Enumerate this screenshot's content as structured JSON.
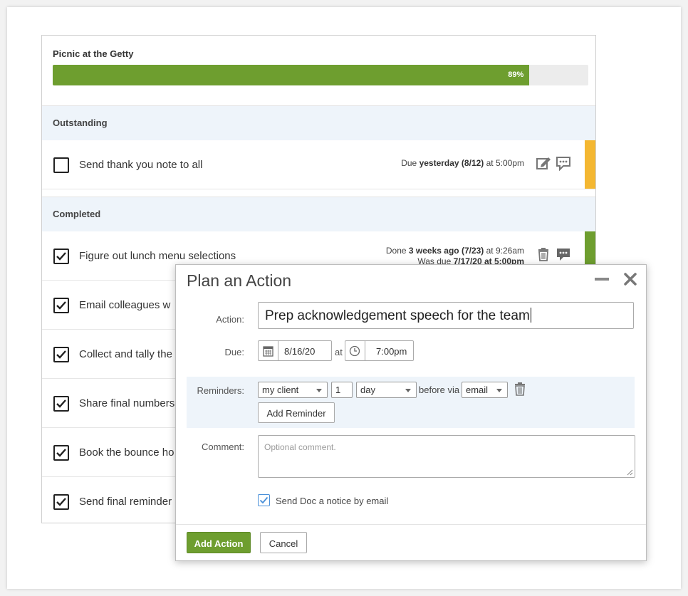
{
  "project": {
    "title": "Picnic at the Getty",
    "progress": 89,
    "progress_label": "89%",
    "progress_color": "#6e9e2f"
  },
  "sections": {
    "outstanding": "Outstanding",
    "completed": "Completed"
  },
  "outstanding_items": [
    {
      "label": "Send thank you note to all",
      "due_prefix": "Due ",
      "due_bold": "yesterday (8/12)",
      "due_suffix": " at 5:00pm",
      "stripe_color": "#f4b731",
      "icons": [
        "edit-icon",
        "comment-icon"
      ]
    }
  ],
  "completed_items": [
    {
      "label": "Figure out lunch menu selections",
      "done_prefix": "Done ",
      "done_bold": "3 weeks ago (7/23)",
      "done_suffix": " at 9:26am",
      "was_due_prefix": "Was due ",
      "was_due_bold": "7/17/20 at 5:00pm",
      "stripe_color": "#6e9e2f",
      "icons": [
        "trash-icon",
        "comment-icon"
      ]
    },
    {
      "label": "Email colleagues w"
    },
    {
      "label": "Collect and tally the"
    },
    {
      "label": "Share final numbers"
    },
    {
      "label": "Book the bounce ho"
    },
    {
      "label": "Send final reminder"
    }
  ],
  "modal": {
    "title": "Plan an Action",
    "action_label": "Action:",
    "action_value": "Prep acknowledgement speech for the team",
    "due_label": "Due:",
    "due_date": "8/16/20",
    "at_label": "at",
    "due_time": "7:00pm",
    "reminders_label": "Reminders:",
    "reminder_who": "my client",
    "reminder_qty": "1",
    "reminder_unit": "day",
    "before_via_label": "before via",
    "reminder_channel": "email",
    "add_reminder_label": "Add Reminder",
    "comment_label": "Comment:",
    "comment_placeholder": "Optional comment.",
    "notice_label": "Send Doc a notice by email",
    "notice_checked": true,
    "add_action_label": "Add Action",
    "cancel_label": "Cancel",
    "accent_color": "#6e9e2f"
  }
}
